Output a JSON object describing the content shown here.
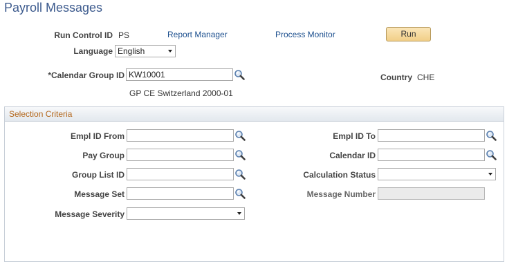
{
  "page": {
    "title": "Payroll Messages"
  },
  "header": {
    "run_control_label": "Run Control ID",
    "run_control_value": "PS",
    "report_manager_link": "Report Manager",
    "process_monitor_link": "Process Monitor",
    "run_button": "Run",
    "language_label": "Language",
    "language_value": "English",
    "calendar_group_label": "*Calendar Group ID",
    "calendar_group_value": "KW10001",
    "calendar_group_desc": "GP CE Switzerland 2000-01",
    "country_label": "Country",
    "country_value": "CHE"
  },
  "selection": {
    "title": "Selection Criteria",
    "empl_from_label": "Empl ID From",
    "empl_from_value": "",
    "empl_to_label": "Empl ID To",
    "empl_to_value": "",
    "pay_group_label": "Pay Group",
    "pay_group_value": "",
    "calendar_id_label": "Calendar ID",
    "calendar_id_value": "",
    "group_list_label": "Group List ID",
    "group_list_value": "",
    "calc_status_label": "Calculation Status",
    "calc_status_value": "",
    "message_set_label": "Message Set",
    "message_set_value": "",
    "message_number_label": "Message Number",
    "message_number_value": "",
    "message_severity_label": "Message Severity",
    "message_severity_value": ""
  },
  "icons": {
    "lookup": "magnifier-lookup-icon",
    "dropdown": "chevron-down-icon"
  }
}
